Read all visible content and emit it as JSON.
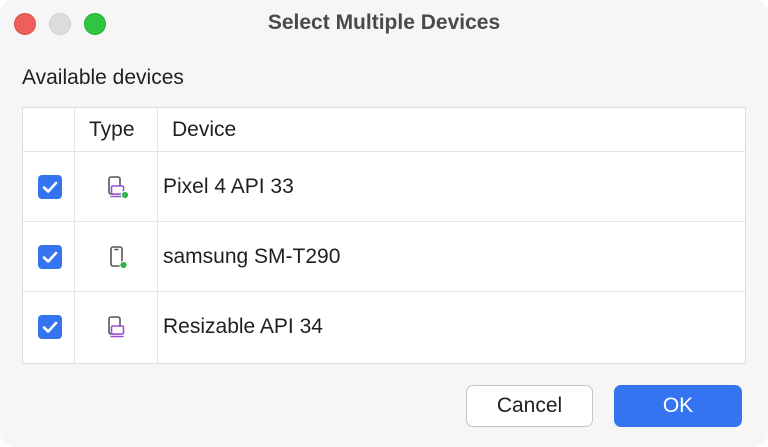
{
  "window": {
    "title": "Select Multiple Devices"
  },
  "section_label": "Available devices",
  "table": {
    "columns": [
      "",
      "Type",
      "Device"
    ],
    "rows": [
      {
        "checked": true,
        "type_icon": "emulator-phone-online-icon",
        "device": "Pixel 4 API 33"
      },
      {
        "checked": true,
        "type_icon": "physical-phone-online-icon",
        "device": "samsung SM-T290"
      },
      {
        "checked": true,
        "type_icon": "emulator-phone-icon",
        "device": "Resizable API 34"
      }
    ]
  },
  "buttons": {
    "cancel": "Cancel",
    "ok": "OK"
  },
  "colors": {
    "accent": "#3574f0",
    "online_dot": "#2fb54a",
    "emulator_icon": "#9c4fd6",
    "close": "#ee5f5b",
    "zoom": "#2fc542"
  }
}
